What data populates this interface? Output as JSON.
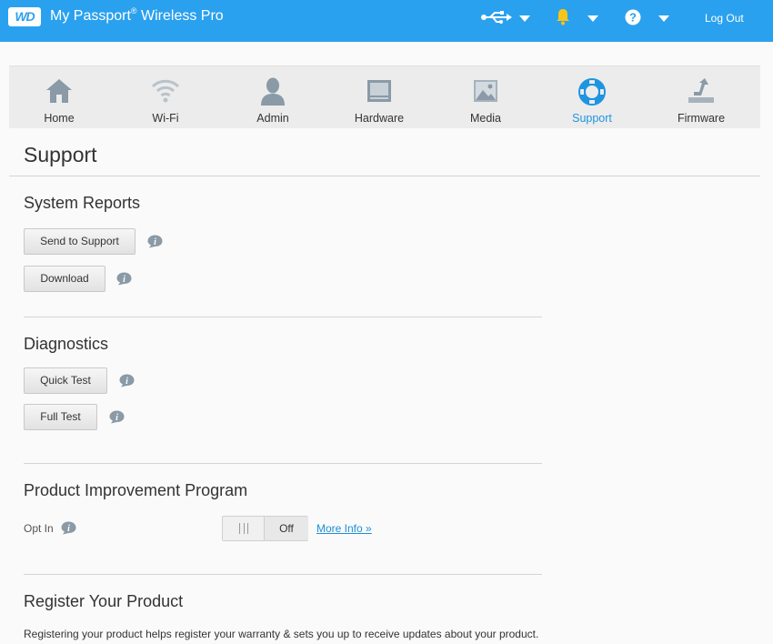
{
  "header": {
    "logo_text": "WD",
    "brand_main": "My Passport",
    "brand_reg": "®",
    "brand_sub": "Wireless Pro",
    "logout_label": "Log Out",
    "icons": [
      "usb-icon",
      "bell-icon",
      "help-icon"
    ],
    "accent": "#2aa1ee",
    "bell_color": "#f5c518"
  },
  "nav": {
    "items": [
      {
        "label": "Home",
        "icon": "home-icon"
      },
      {
        "label": "Wi-Fi",
        "icon": "wifi-icon"
      },
      {
        "label": "Admin",
        "icon": "user-icon"
      },
      {
        "label": "Hardware",
        "icon": "hardware-icon"
      },
      {
        "label": "Media",
        "icon": "media-icon"
      },
      {
        "label": "Support",
        "icon": "lifebuoy-icon"
      },
      {
        "label": "Firmware",
        "icon": "firmware-icon"
      }
    ],
    "active": "Support",
    "active_color": "#1e95e0"
  },
  "page": {
    "title": "Support"
  },
  "system_reports": {
    "title": "System Reports",
    "send_label": "Send to Support",
    "download_label": "Download"
  },
  "diagnostics": {
    "title": "Diagnostics",
    "quick_label": "Quick Test",
    "full_label": "Full Test"
  },
  "improvement": {
    "title": "Product Improvement Program",
    "optin_label": "Opt In",
    "toggle_state": "Off",
    "more_info": "More Info »"
  },
  "register": {
    "title": "Register Your Product",
    "description": "Registering your product helps register your warranty & sets you up to receive updates about your product."
  }
}
